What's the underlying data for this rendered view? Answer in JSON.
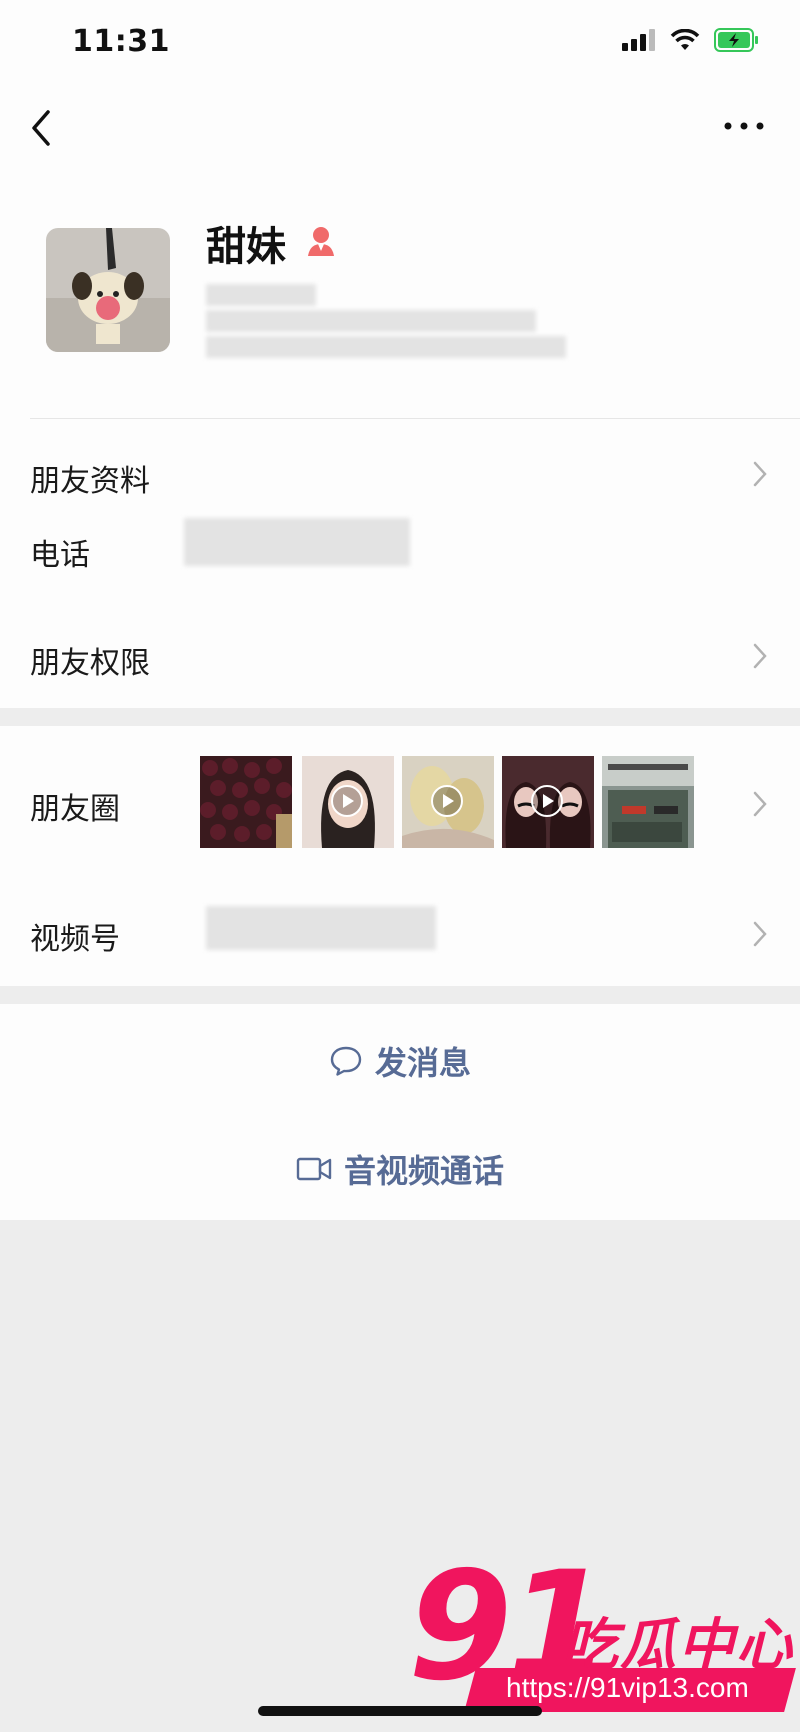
{
  "status_bar": {
    "time": "11:31"
  },
  "profile": {
    "name": "甜妹"
  },
  "rows": {
    "friend_info": "朋友资料",
    "phone": "电话",
    "friend_permissions": "朋友权限",
    "moments": "朋友圈",
    "channels": "视频号"
  },
  "actions": {
    "message": "发消息",
    "call": "音视频通话"
  },
  "watermark": {
    "number": "91",
    "text": "吃瓜中心",
    "url": "https://91vip13.com"
  },
  "colors": {
    "link": "#576b95",
    "watermark": "#f0155e",
    "gender_icon": "#f06a6a",
    "battery": "#35c759"
  }
}
